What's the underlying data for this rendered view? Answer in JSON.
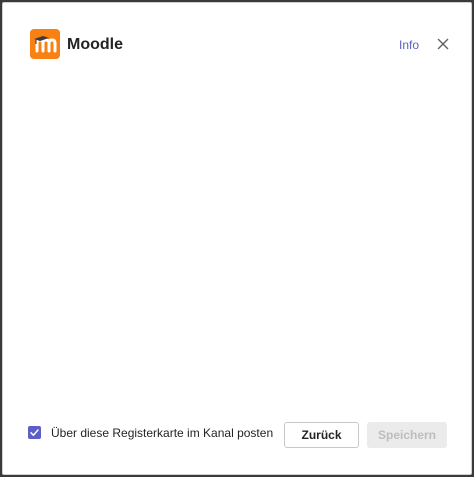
{
  "dialog": {
    "app_name": "Moodle",
    "app_icon": "moodle-logo-icon",
    "info_label": "Info",
    "close_icon": "close-icon"
  },
  "footer": {
    "checkbox_label": "Über diese Registerkarte im Kanal posten",
    "checkbox_checked": true,
    "back_label": "Zurück",
    "save_label": "Speichern",
    "save_enabled": false
  },
  "colors": {
    "brand_orange": "#f98012",
    "accent": "#5b5fc7",
    "disabled_bg": "#ebebeb",
    "disabled_text": "#bdbdbd"
  }
}
